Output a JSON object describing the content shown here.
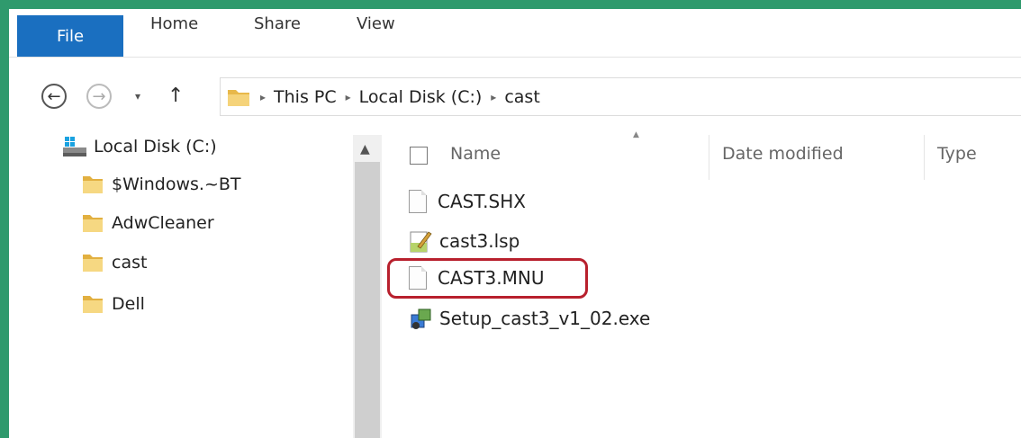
{
  "ribbon": {
    "tabs": [
      "File",
      "Home",
      "Share",
      "View"
    ]
  },
  "address_bar": {
    "path": [
      "This PC",
      "Local Disk (C:)",
      "cast"
    ],
    "separator": "▸"
  },
  "nav_pane": {
    "drive": "Local Disk (C:)",
    "folders": [
      "$Windows.~BT",
      "AdwCleaner",
      "cast",
      "Dell"
    ]
  },
  "file_list": {
    "columns": [
      "Name",
      "Date modified",
      "Type"
    ],
    "files": [
      "CAST.SHX",
      "cast3.lsp",
      "CAST3.MNU",
      "Setup_cast3_v1_02.exe"
    ]
  },
  "colors": {
    "window_border": "#2f9a6d",
    "file_tab": "#1a6fc0",
    "highlight": "#b8202d"
  }
}
